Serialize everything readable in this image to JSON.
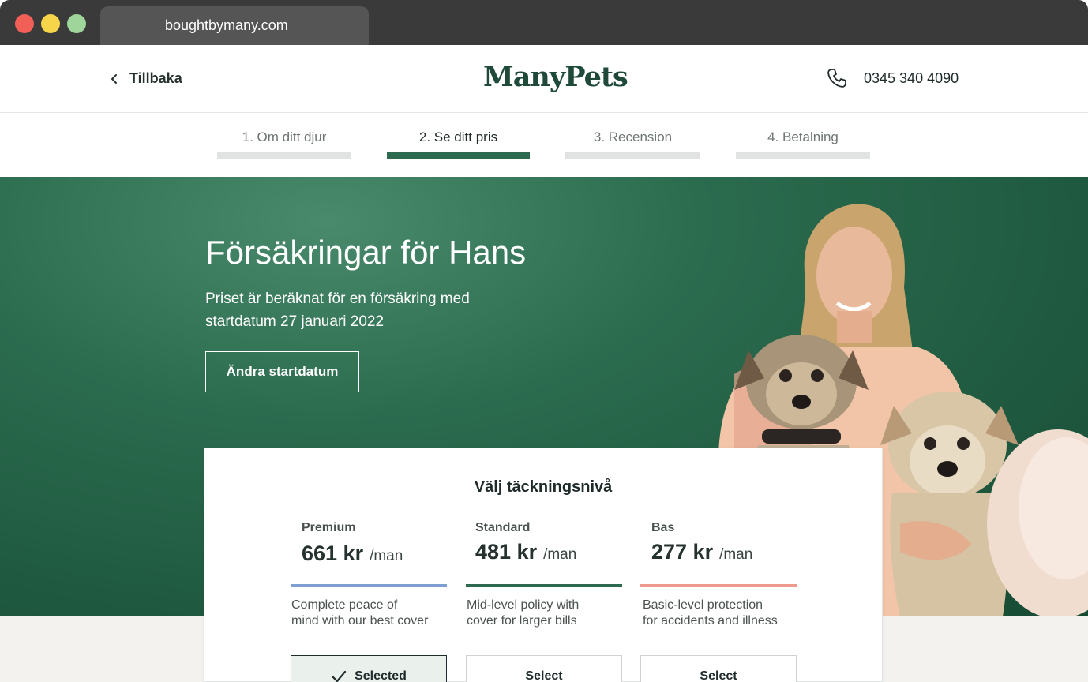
{
  "browser": {
    "tab_title": "boughtbymany.com"
  },
  "header": {
    "back_label": "Tillbaka",
    "logo": "ManyPets",
    "phone": "0345 340 4090"
  },
  "steps": [
    {
      "label": "1. Om ditt djur",
      "active": false
    },
    {
      "label": "2. Se ditt pris",
      "active": true
    },
    {
      "label": "3. Recension",
      "active": false
    },
    {
      "label": "4. Betalning",
      "active": false
    }
  ],
  "hero": {
    "title": "Försäkringar för Hans",
    "subtitle_line1": "Priset är beräknat för en försäkring med",
    "subtitle_line2": "startdatum 27 januari 2022",
    "change_date_button": "Ändra startdatum"
  },
  "coverage": {
    "title": "Välj täckningsnivå",
    "plans": [
      {
        "name": "Premium",
        "price": "661 kr",
        "per": "/man",
        "desc_line1": "Complete peace of",
        "desc_line2": "mind with our best cover",
        "button": "Selected",
        "selected": true,
        "color": "#7f9ed3"
      },
      {
        "name": "Standard",
        "price": "481 kr",
        "per": "/man",
        "desc_line1": "Mid-level policy with",
        "desc_line2": "cover for larger bills",
        "button": "Select",
        "selected": false,
        "color": "#2e6a4f"
      },
      {
        "name": "Bas",
        "price": "277 kr",
        "per": "/man",
        "desc_line1": "Basic-level protection",
        "desc_line2": "for accidents and illness",
        "button": "Select",
        "selected": false,
        "color": "#ee9a8f"
      }
    ]
  },
  "colors": {
    "brand_green": "#1f4a3a",
    "hero_green": "#2b6b4e",
    "step_active": "#2e6a4f"
  }
}
